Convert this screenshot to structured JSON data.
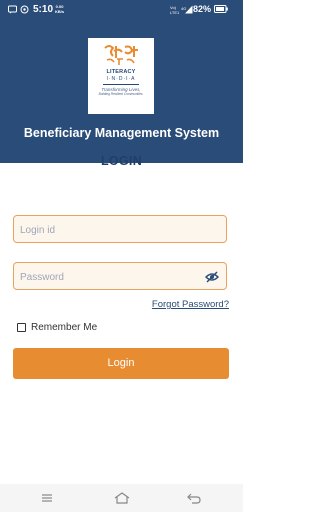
{
  "status_bar": {
    "time": "5:10",
    "net_speed_value": "0.00",
    "net_speed_unit": "KB/s",
    "volte": "Vo)",
    "volte2": "LTE1",
    "signal_label": "4G",
    "battery": "82%"
  },
  "logo": {
    "line1": "LITERACY",
    "line2": "I·N·D·I·A",
    "line3": "Transforming Lives,",
    "line4": "Building Resilient Communities."
  },
  "header": {
    "title": "Beneficiary Management System"
  },
  "form": {
    "heading": "LOGIN",
    "login_id_placeholder": "Login id",
    "password_placeholder": "Password",
    "forgot_password": "Forgot Password?",
    "remember_me": "Remember Me",
    "login_button": "Login"
  },
  "colors": {
    "header_bg": "#2a4c78",
    "accent": "#e88c31",
    "input_border": "#e9a35c",
    "input_bg": "#fdf6ec",
    "heading_text": "#213e6a"
  },
  "icons": {
    "password_toggle": "eye-off-icon",
    "nav_menu": "menu-icon",
    "nav_home": "home-icon",
    "nav_back": "back-icon"
  }
}
